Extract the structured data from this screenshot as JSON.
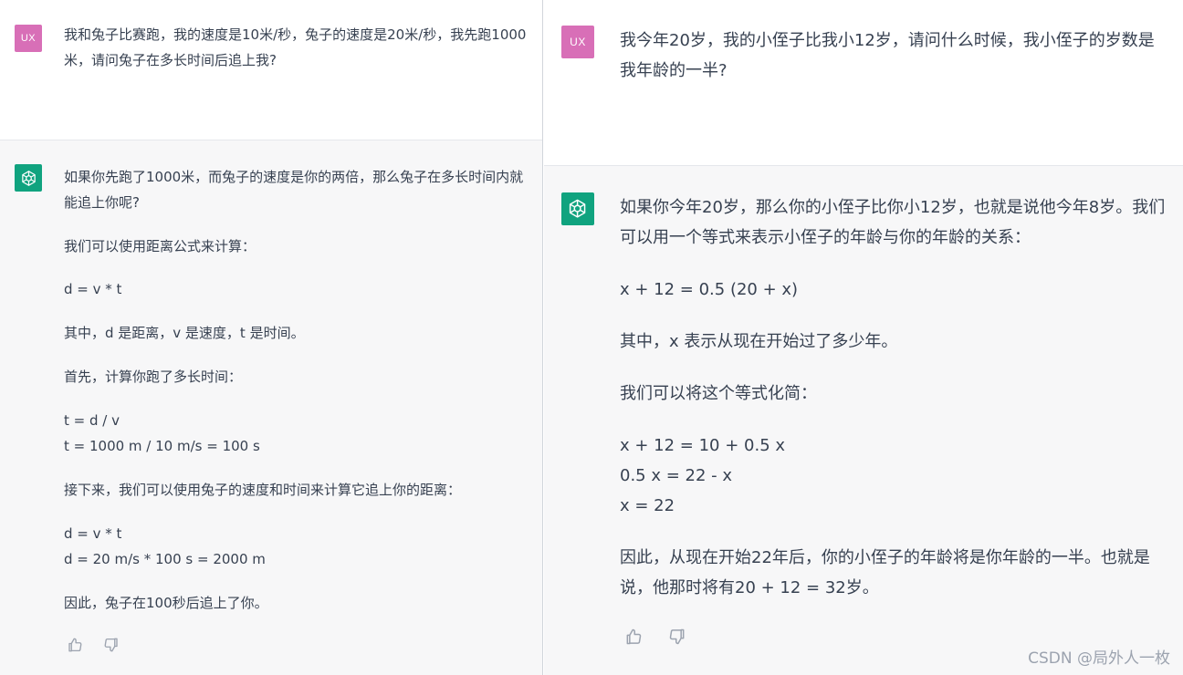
{
  "left": {
    "user": {
      "avatar_text": "UX",
      "message": "我和兔子比赛跑，我的速度是10米/秒，兔子的速度是20米/秒，我先跑1000米，请问兔子在多长时间后追上我?"
    },
    "assistant": {
      "paragraphs": [
        "如果你先跑了1000米，而兔子的速度是你的两倍，那么兔子在多长时间内就能追上你呢?",
        "我们可以使用距离公式来计算：",
        "d = v * t",
        "其中，d 是距离，v 是速度，t 是时间。",
        "首先，计算你跑了多长时间：",
        "t = d / v\nt = 1000 m / 10 m/s = 100 s",
        "接下来，我们可以使用兔子的速度和时间来计算它追上你的距离：",
        "d = v * t\nd = 20 m/s * 100 s = 2000 m",
        "因此，兔子在100秒后追上了你。"
      ]
    }
  },
  "right": {
    "user": {
      "avatar_text": "UX",
      "message": "我今年20岁，我的小侄子比我小12岁，请问什么时候，我小侄子的岁数是我年龄的一半?"
    },
    "assistant": {
      "paragraphs": [
        "如果你今年20岁，那么你的小侄子比你小12岁，也就是说他今年8岁。我们可以用一个等式来表示小侄子的年龄与你的年龄的关系：",
        "x + 12 = 0.5 (20 + x)",
        "其中，x 表示从现在开始过了多少年。",
        "我们可以将这个等式化简：",
        "x + 12 = 10 + 0.5 x\n0.5 x = 22 - x\nx = 22",
        "因此，从现在开始22年后，你的小侄子的年龄将是你年龄的一半。也就是说，他那时将有20 + 12 = 32岁。"
      ]
    }
  },
  "watermark": "CSDN @局外人一枚",
  "colors": {
    "user_avatar": "#d86fb7",
    "bot_avatar": "#10a37f",
    "assistant_bg": "#f7f7f8",
    "text": "#374151"
  },
  "icons": {
    "bot": "openai-logo-icon",
    "like": "thumbs-up-icon",
    "dislike": "thumbs-down-icon"
  }
}
